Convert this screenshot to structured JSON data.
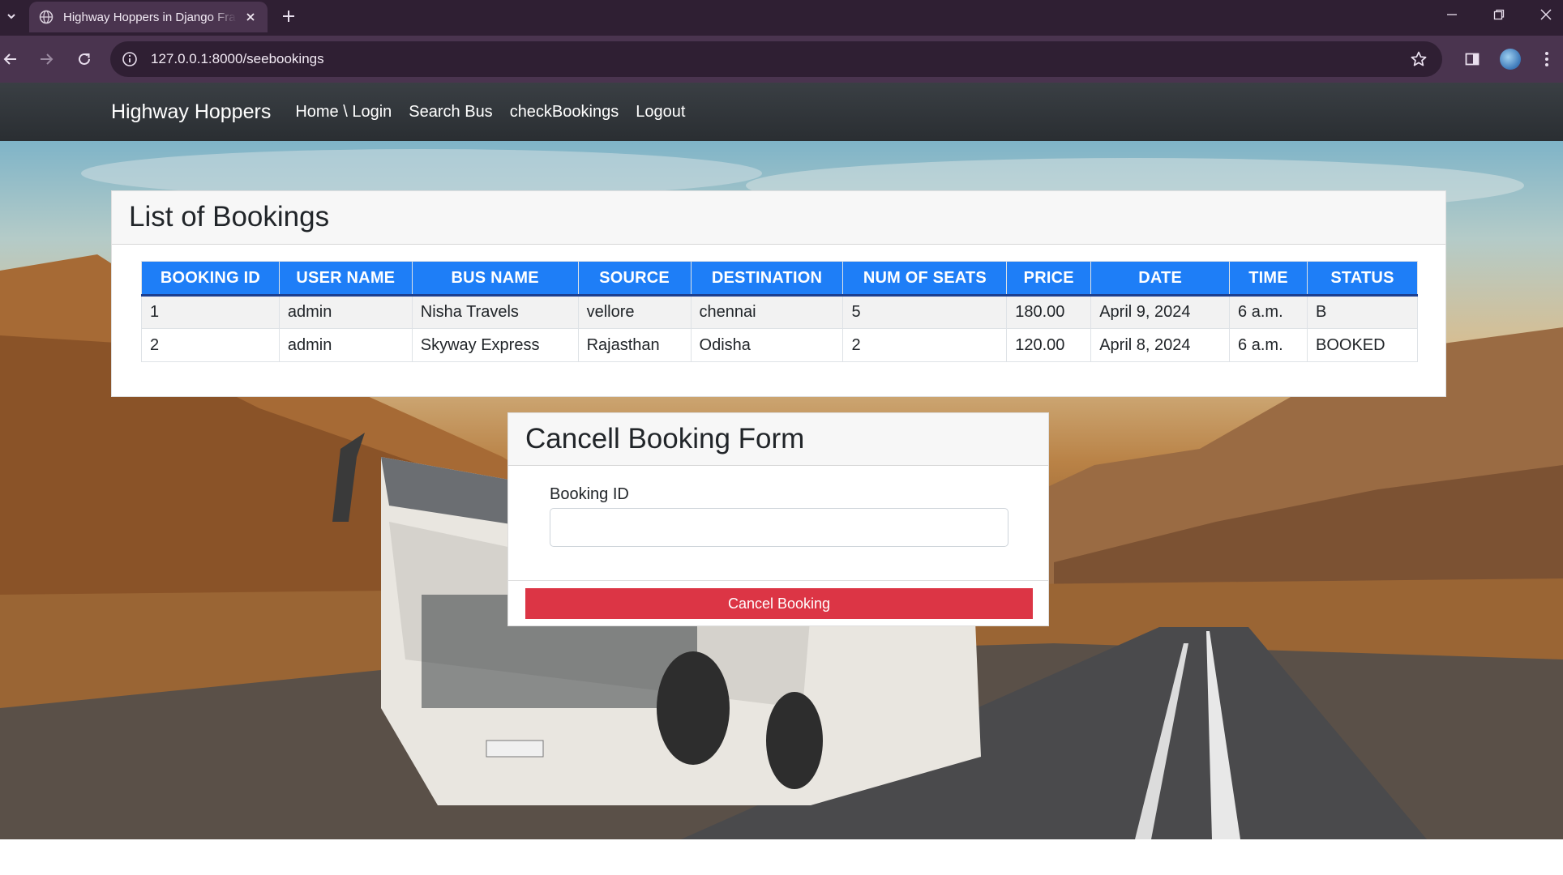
{
  "browser": {
    "tab_title": "Highway Hoppers in Django Fra",
    "url": "127.0.0.1:8000/seebookings"
  },
  "navbar": {
    "brand": "Highway Hoppers",
    "links": [
      "Home \\ Login",
      "Search Bus",
      "checkBookings",
      "Logout"
    ]
  },
  "bookings": {
    "title": "List of Bookings",
    "columns": [
      "BOOKING ID",
      "USER NAME",
      "BUS NAME",
      "SOURCE",
      "DESTINATION",
      "NUM OF SEATS",
      "PRICE",
      "DATE",
      "TIME",
      "STATUS"
    ],
    "rows": [
      [
        "1",
        "admin",
        "Nisha Travels",
        "vellore",
        "chennai",
        "5",
        "180.00",
        "April 9, 2024",
        "6 a.m.",
        "B"
      ],
      [
        "2",
        "admin",
        "Skyway Express",
        "Rajasthan",
        "Odisha",
        "2",
        "120.00",
        "April 8, 2024",
        "6 a.m.",
        "BOOKED"
      ]
    ]
  },
  "cancel_form": {
    "title": "Cancell Booking Form",
    "field_label": "Booking ID",
    "field_value": "",
    "button_label": "Cancel Booking"
  },
  "colors": {
    "table_header": "#1e7ef7",
    "cancel_button": "#dc3545",
    "navbar": "#343a40"
  },
  "icons": [
    "tab-list-icon",
    "globe-icon",
    "close-tab-icon",
    "new-tab-icon",
    "minimize-icon",
    "restore-icon",
    "close-window-icon",
    "back-icon",
    "forward-icon",
    "reload-icon",
    "site-info-icon",
    "bookmark-star-icon",
    "side-panel-icon",
    "profile-avatar-icon",
    "menu-icon"
  ]
}
